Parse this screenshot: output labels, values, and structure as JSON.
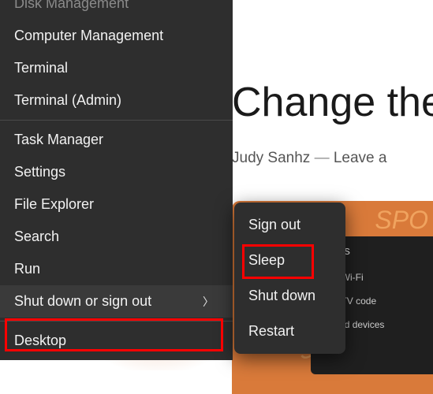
{
  "background": {
    "title": "Change the",
    "author": "Judy Sanhz",
    "separator": "—",
    "leave": "Leave a",
    "panel": {
      "header": "ttings",
      "r1": "with Wi-Fi",
      "r2": "with TV code",
      "r3": "Linked devices"
    }
  },
  "menu": {
    "group0": [
      {
        "label": "Disk Management",
        "faded": true
      },
      {
        "label": "Computer Management",
        "faded": false
      },
      {
        "label": "Terminal",
        "faded": false
      },
      {
        "label": "Terminal (Admin)",
        "faded": false
      }
    ],
    "group1": [
      {
        "label": "Task Manager"
      },
      {
        "label": "Settings"
      },
      {
        "label": "File Explorer"
      },
      {
        "label": "Search"
      },
      {
        "label": "Run"
      },
      {
        "label": "Shut down or sign out",
        "hovered": true,
        "chevron": true
      }
    ],
    "group2": [
      {
        "label": "Desktop"
      }
    ]
  },
  "submenu": {
    "items": [
      {
        "label": "Sign out"
      },
      {
        "label": "Sleep"
      },
      {
        "label": "Shut down"
      },
      {
        "label": "Restart"
      }
    ]
  }
}
